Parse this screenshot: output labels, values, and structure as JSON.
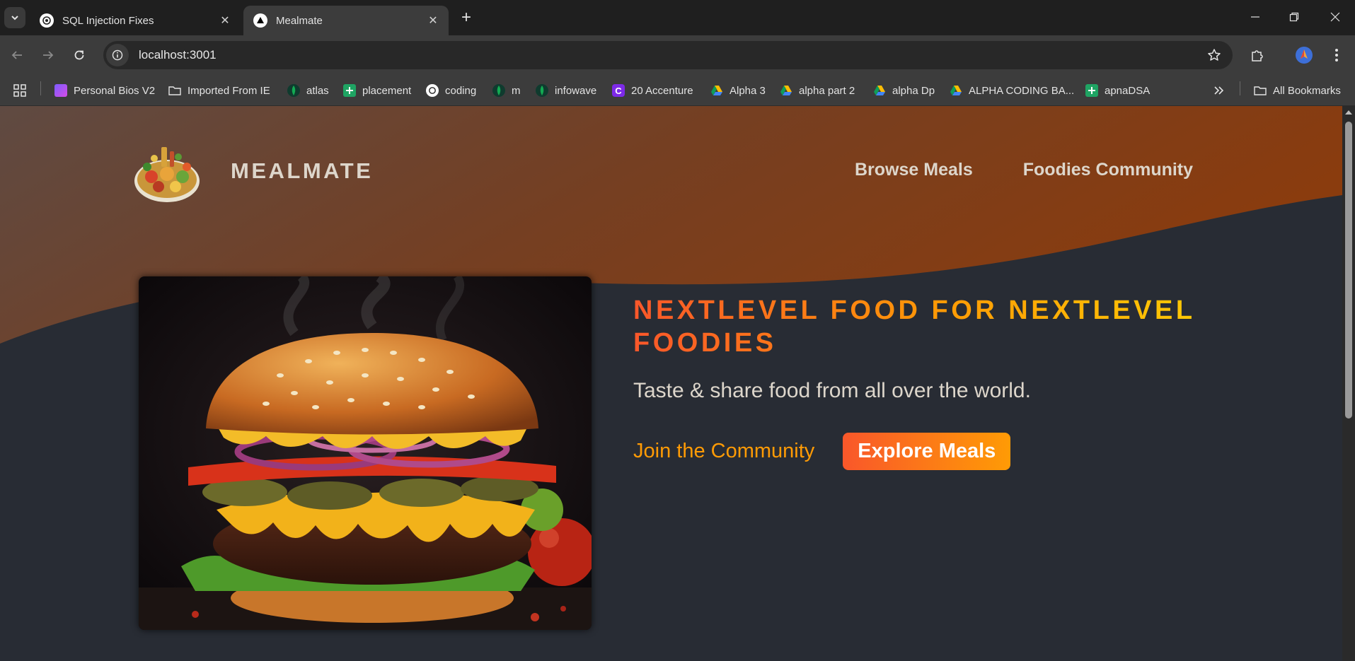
{
  "browser": {
    "tabs": [
      {
        "title": "SQL Injection Fixes",
        "favicon": "openai-icon"
      },
      {
        "title": "Mealmate",
        "favicon": "nextjs-icon"
      }
    ],
    "url": "localhost:3001",
    "bookmarks": [
      {
        "label": "Personal Bios V2",
        "icon": "personal-bios-icon"
      },
      {
        "label": "Imported From IE",
        "icon": "folder-icon"
      },
      {
        "label": "atlas",
        "icon": "mongodb-icon"
      },
      {
        "label": "placement",
        "icon": "sheets-icon"
      },
      {
        "label": "coding",
        "icon": "openai-icon"
      },
      {
        "label": "m",
        "icon": "mongodb-icon"
      },
      {
        "label": "infowave",
        "icon": "mongodb-icon"
      },
      {
        "label": "20 Accenture",
        "icon": "canva-icon"
      },
      {
        "label": "Alpha 3",
        "icon": "drive-icon"
      },
      {
        "label": "alpha part 2",
        "icon": "drive-icon"
      },
      {
        "label": "alpha Dp",
        "icon": "drive-icon"
      },
      {
        "label": "ALPHA CODING BA...",
        "icon": "drive-icon"
      },
      {
        "label": "apnaDSA",
        "icon": "sheets-icon"
      }
    ],
    "all_bookmarks_label": "All Bookmarks"
  },
  "site": {
    "logo_text": "MealMate",
    "nav": [
      {
        "label": "Browse Meals"
      },
      {
        "label": "Foodies Community"
      }
    ],
    "hero": {
      "title": "NextLevel Food for NextLevel Foodies",
      "subtitle": "Taste & share food from all over the world.",
      "join_link": "Join the Community",
      "explore_button": "Explore Meals"
    }
  },
  "colors": {
    "header_brown": "#6b4a3a",
    "header_orange": "#8a3c10",
    "page_bg": "#282c34",
    "accent_orange": "#ff9b05",
    "accent_red": "#f9572a",
    "nav_text": "#ddd6cb"
  }
}
